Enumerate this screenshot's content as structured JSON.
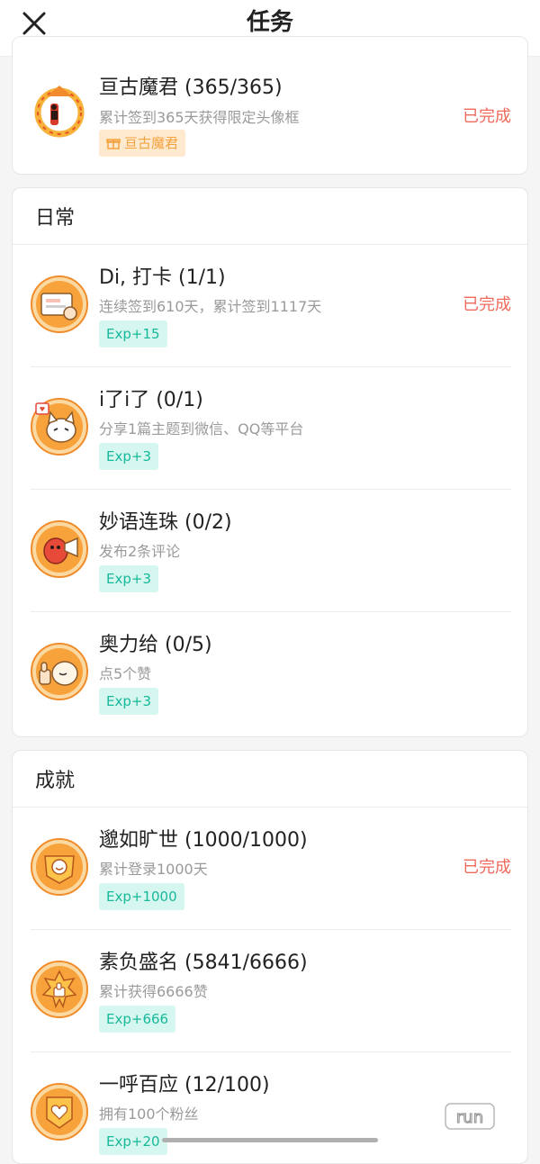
{
  "header": {
    "title": "任务"
  },
  "top_task": {
    "name": "亘古魔君 (365/365)",
    "desc": "累计签到365天获得限定头像框",
    "badge": "亘古魔君",
    "status": "已完成",
    "icon": "demon-avatar-frame-icon"
  },
  "daily": {
    "title": "日常",
    "tasks": [
      {
        "name": "Di, 打卡 (1/1)",
        "desc": "连续签到610天，累计签到1117天",
        "badge": "Exp+15",
        "status": "已完成",
        "icon": "checkin-card-icon"
      },
      {
        "name": "i了i了 (0/1)",
        "desc": "分享1篇主题到微信、QQ等平台",
        "badge": "Exp+3",
        "status": "",
        "icon": "share-cat-icon"
      },
      {
        "name": "妙语连珠 (0/2)",
        "desc": "发布2条评论",
        "badge": "Exp+3",
        "status": "",
        "icon": "comment-megaphone-icon"
      },
      {
        "name": "奥力给 (0/5)",
        "desc": "点5个赞",
        "badge": "Exp+3",
        "status": "",
        "icon": "thumbs-up-cat-icon"
      }
    ]
  },
  "achievements": {
    "title": "成就",
    "tasks": [
      {
        "name": "邈如旷世 (1000/1000)",
        "desc": "累计登录1000天",
        "badge": "Exp+1000",
        "status": "已完成",
        "icon": "login-medal-icon"
      },
      {
        "name": "素负盛名 (5841/6666)",
        "desc": "累计获得6666赞",
        "badge": "Exp+666",
        "status": "",
        "icon": "like-medal-icon"
      },
      {
        "name": "一呼百应 (12/100)",
        "desc": "拥有100个粉丝",
        "badge": "Exp+20",
        "status": "",
        "icon": "heart-medal-icon"
      }
    ]
  },
  "watermark": "run"
}
